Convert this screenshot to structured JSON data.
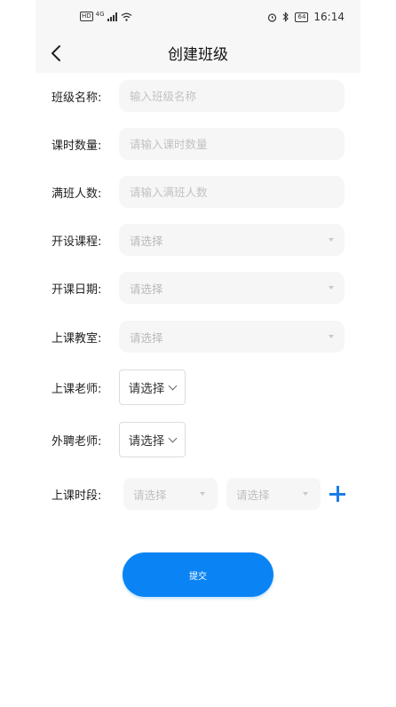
{
  "status_bar": {
    "hd": "HD",
    "network": "4G",
    "battery": "64",
    "time": "16:14"
  },
  "nav": {
    "title": "创建班级"
  },
  "form": {
    "class_name": {
      "label": "班级名称:",
      "placeholder": "输入班级名称"
    },
    "hours": {
      "label": "课时数量:",
      "placeholder": "请输入课时数量"
    },
    "capacity": {
      "label": "满班人数:",
      "placeholder": "请输入满班人数"
    },
    "course": {
      "label": "开设课程:",
      "value": "请选择"
    },
    "start_date": {
      "label": "开课日期:",
      "value": "请选择"
    },
    "classroom": {
      "label": "上课教室:",
      "value": "请选择"
    },
    "teacher": {
      "label": "上课老师:",
      "value": "请选择"
    },
    "external_teacher": {
      "label": "外聘老师:",
      "value": "请选择"
    },
    "time_slot": {
      "label": "上课时段:",
      "start": "请选择",
      "end": "请选择"
    }
  },
  "submit_label": "提交",
  "colors": {
    "accent": "#0a84f4",
    "field_bg": "#f6f6f6",
    "header_bg": "#f7f7f7"
  }
}
